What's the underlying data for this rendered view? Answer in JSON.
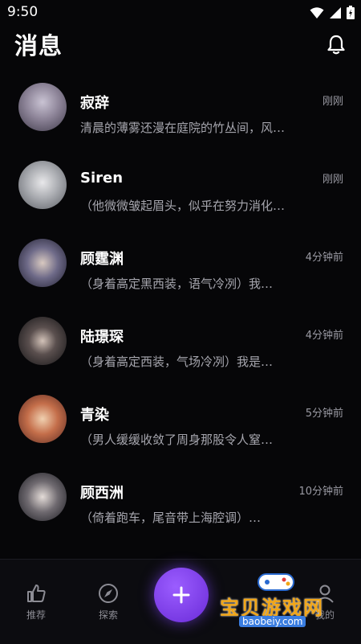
{
  "status_bar": {
    "time": "9:50"
  },
  "header": {
    "title": "消息"
  },
  "conversations": [
    {
      "name": "寂辞",
      "time": "刚刚",
      "preview": "清晨的薄雾还漫在庭院的竹丛间，风…"
    },
    {
      "name": "Siren",
      "time": "刚刚",
      "preview": "（他微微皱起眉头，似乎在努力消化…"
    },
    {
      "name": "顾霆渊",
      "time": "4分钟前",
      "preview": "（身着高定黑西装，语气冷冽）我…"
    },
    {
      "name": "陆璟琛",
      "time": "4分钟前",
      "preview": "（身着高定西装，气场冷冽）我是…"
    },
    {
      "name": "青染",
      "time": "5分钟前",
      "preview": "（男人缓缓收敛了周身那股令人窒…"
    },
    {
      "name": "顾西洲",
      "time": "10分钟前",
      "preview": "（倚着跑车，尾音带上海腔调）…"
    }
  ],
  "nav": {
    "items": [
      {
        "label": "推荐",
        "icon": "thumbs-up-icon"
      },
      {
        "label": "探索",
        "icon": "compass-icon"
      },
      {
        "label": "我的",
        "icon": "user-icon"
      }
    ],
    "fab_icon": "plus-icon"
  },
  "watermark": {
    "text": "宝贝游戏网",
    "url": "baobeiy.com"
  },
  "colors": {
    "accent": "#7b3ff0",
    "background": "#060608",
    "muted_text": "#a5a5ad"
  }
}
